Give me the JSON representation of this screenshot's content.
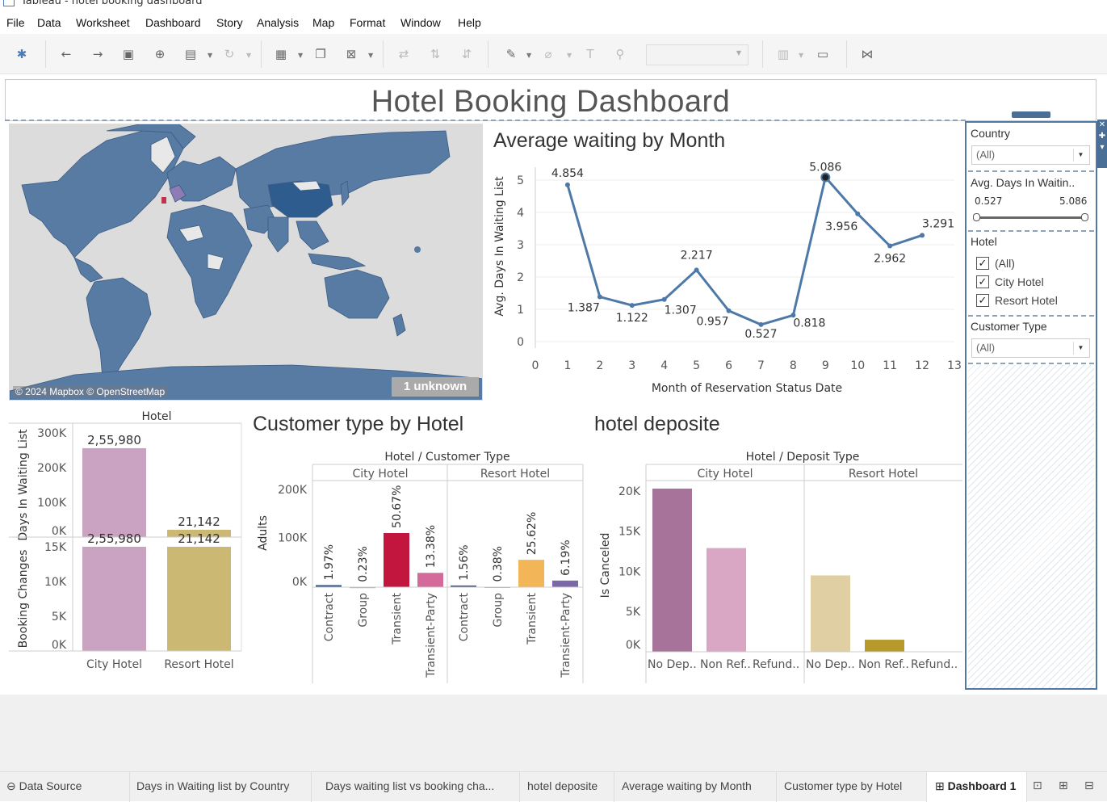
{
  "window": {
    "title": "Tableau - hotel booking dashboard"
  },
  "menu": [
    "File",
    "Data",
    "Worksheet",
    "Dashboard",
    "Story",
    "Analysis",
    "Map",
    "Format",
    "Window",
    "Help"
  ],
  "dashboard": {
    "title": "Hotel Booking Dashboard"
  },
  "map": {
    "attribution": "© 2024 Mapbox © OpenStreetMap",
    "unknown_badge": "1 unknown"
  },
  "avg_chart": {
    "title": "Average waiting by Month"
  },
  "cust_chart": {
    "title": "Customer type by Hotel"
  },
  "deposit_chart": {
    "title": "hotel deposite"
  },
  "filters": {
    "country": {
      "label": "Country",
      "value": "(All)"
    },
    "avg_days": {
      "label": "Avg. Days In Waitin..",
      "min": "0.527",
      "max": "5.086"
    },
    "hotel": {
      "label": "Hotel",
      "options": [
        "(All)",
        "City Hotel",
        "Resort Hotel"
      ]
    },
    "customer_type": {
      "label": "Customer Type",
      "value": "(All)"
    }
  },
  "tabs": [
    "Data Source",
    "Days in Waiting list by Country",
    "Days waiting list vs booking cha...",
    "hotel deposite",
    "Average waiting by Month",
    "Customer type by Hotel",
    "Dashboard 1"
  ],
  "chart_data": [
    {
      "type": "line",
      "title": "Average waiting by Month",
      "xlabel": "Month of Reservation Status Date",
      "ylabel": "Avg. Days In Waiting List",
      "x": [
        1,
        2,
        3,
        4,
        5,
        6,
        7,
        8,
        9,
        10,
        11,
        12
      ],
      "values": [
        4.854,
        1.387,
        1.122,
        1.307,
        2.217,
        0.957,
        0.527,
        0.818,
        5.086,
        3.956,
        2.962,
        3.291
      ],
      "data_labels": [
        "4.854",
        "1.387",
        "1.122",
        "1.307",
        "2.217",
        "0.957",
        "0.527",
        "0.818",
        "5.086",
        "3.956",
        "2.962",
        "3.291"
      ],
      "x_ticks": [
        "0",
        "1",
        "2",
        "3",
        "4",
        "5",
        "6",
        "7",
        "8",
        "9",
        "10",
        "11",
        "12",
        "13"
      ],
      "y_ticks": [
        "0",
        "1",
        "2",
        "3",
        "4",
        "5"
      ],
      "xlim": [
        0,
        13
      ],
      "ylim": [
        0,
        5.2
      ],
      "color": "#4e79a7"
    },
    {
      "type": "bar",
      "title": "Hotel",
      "categories": [
        "City Hotel",
        "Resort Hotel"
      ],
      "series": [
        {
          "name": "Days In Waiting List",
          "values": [
            255980,
            21142
          ],
          "labels": [
            "2,55,980",
            "21,142"
          ],
          "ylim": [
            0,
            300000
          ],
          "ticks": [
            "0K",
            "100K",
            "200K",
            "300K"
          ]
        },
        {
          "name": "Booking Changes",
          "values": [
            255980,
            21142
          ],
          "labels": [
            "2,55,980",
            "21,142"
          ],
          "ylim": [
            0,
            15000
          ],
          "ticks": [
            "0K",
            "5K",
            "10K",
            "15K"
          ]
        }
      ],
      "colors": [
        "#c9a3c1",
        "#cbb872"
      ]
    },
    {
      "type": "bar",
      "title": "Hotel / Customer Type",
      "ylabel": "Adults",
      "groups": [
        "City Hotel",
        "Resort Hotel"
      ],
      "categories": [
        "Contract",
        "Group",
        "Transient",
        "Transient-Party"
      ],
      "series": [
        {
          "name": "City Hotel",
          "values": [
            1.97,
            0.23,
            50.67,
            13.38
          ],
          "labels": [
            "1.97%",
            "0.23%",
            "50.67%",
            "13.38%"
          ],
          "colors": [
            "#3c5a8a",
            "#9aa9bf",
            "#c2163e",
            "#d36a9a"
          ]
        },
        {
          "name": "Resort Hotel",
          "values": [
            1.56,
            0.38,
            25.62,
            6.19
          ],
          "labels": [
            "1.56%",
            "0.38%",
            "25.62%",
            "6.19%"
          ],
          "colors": [
            "#3c5a8a",
            "#9aa9bf",
            "#f2b659",
            "#7b68a8"
          ]
        }
      ],
      "y_ticks": [
        "0K",
        "100K",
        "200K"
      ]
    },
    {
      "type": "bar",
      "title": "Hotel / Deposit Type",
      "ylabel": "Is Canceled",
      "groups": [
        "City Hotel",
        "Resort Hotel"
      ],
      "categories": [
        "No Dep..",
        "Non Ref..",
        "Refund.."
      ],
      "series": [
        {
          "name": "City Hotel",
          "values": [
            20300,
            12900,
            0
          ],
          "colors": [
            "#a7739a",
            "#d9a7c4",
            "#ddd"
          ]
        },
        {
          "name": "Resort Hotel",
          "values": [
            9500,
            1500,
            0
          ],
          "colors": [
            "#e0cfa3",
            "#b89a2c",
            "#ddd"
          ]
        }
      ],
      "y_ticks": [
        "0K",
        "5K",
        "10K",
        "15K",
        "20K"
      ],
      "ylim": [
        0,
        21000
      ]
    }
  ]
}
